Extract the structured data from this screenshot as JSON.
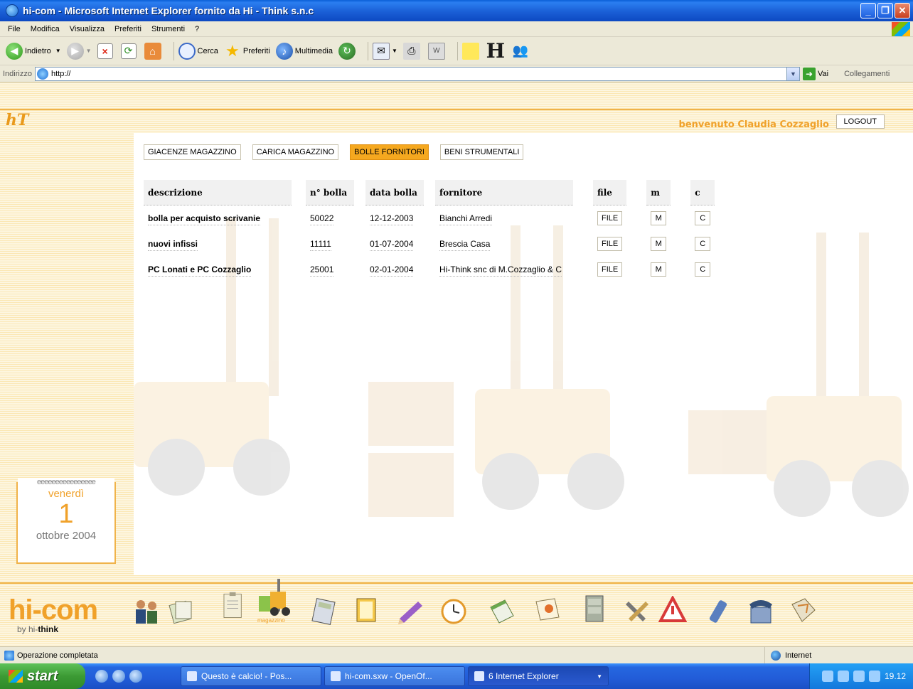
{
  "window": {
    "title": "hi-com - Microsoft Internet Explorer fornito da Hi - Think s.n.c"
  },
  "menu": [
    "File",
    "Modifica",
    "Visualizza",
    "Preferiti",
    "Strumenti",
    "?"
  ],
  "toolbar": {
    "back": "Indietro",
    "search": "Cerca",
    "favorites": "Preferiti",
    "media": "Multimedia"
  },
  "address": {
    "label": "Indirizzo",
    "value": "http://",
    "go": "Vai",
    "links": "Collegamenti"
  },
  "header": {
    "welcome": "benvenuto Claudia Cozzaglio",
    "logout": "LOGOUT"
  },
  "tabs": [
    {
      "label": "GIACENZE MAGAZZINO",
      "active": false
    },
    {
      "label": "CARICA MAGAZZINO",
      "active": false
    },
    {
      "label": "BOLLE FORNITORI",
      "active": true
    },
    {
      "label": "BENI STRUMENTALI",
      "active": false
    }
  ],
  "table": {
    "headers": {
      "descrizione": "descrizione",
      "numero": "n° bolla",
      "data": "data bolla",
      "fornitore": "fornitore",
      "file": "file",
      "m": "m",
      "c": "c"
    },
    "rows": [
      {
        "descrizione": "bolla per acquisto scrivanie",
        "numero": "50022",
        "data": "12-12-2003",
        "fornitore": "Bianchi Arredi",
        "file": "FILE",
        "m": "M",
        "c": "C"
      },
      {
        "descrizione": "nuovi infissi",
        "numero": "11111",
        "data": "01-07-2004",
        "fornitore": "Brescia Casa",
        "file": "FILE",
        "m": "M",
        "c": "C"
      },
      {
        "descrizione": "PC Lonati e PC Cozzaglio",
        "numero": "25001",
        "data": "02-01-2004",
        "fornitore": "Hi-Think snc di M.Cozzaglio & C",
        "file": "FILE",
        "m": "M",
        "c": "C"
      }
    ]
  },
  "calendar": {
    "rings": "eeeeeeeeeeeeeeee",
    "weekday": "venerdì",
    "day": "1",
    "month": "ottobre 2004"
  },
  "bottom": {
    "brand": "hi-com",
    "by": "by hi-",
    "by_bold": "think",
    "magazzino": "magazzino"
  },
  "status": {
    "text": "Operazione completata",
    "zone": "Internet"
  },
  "taskbar": {
    "start": "start",
    "tasks": [
      {
        "label": "Questo è calcio! - Pos...",
        "active": false
      },
      {
        "label": "hi-com.sxw - OpenOf...",
        "active": false
      },
      {
        "label": "6 Internet Explorer",
        "active": true
      }
    ],
    "clock": "19.12"
  },
  "colors": {
    "accent": "#f0a12a",
    "active_tab": "#f5a81f",
    "xp_blue": "#225cd8"
  }
}
